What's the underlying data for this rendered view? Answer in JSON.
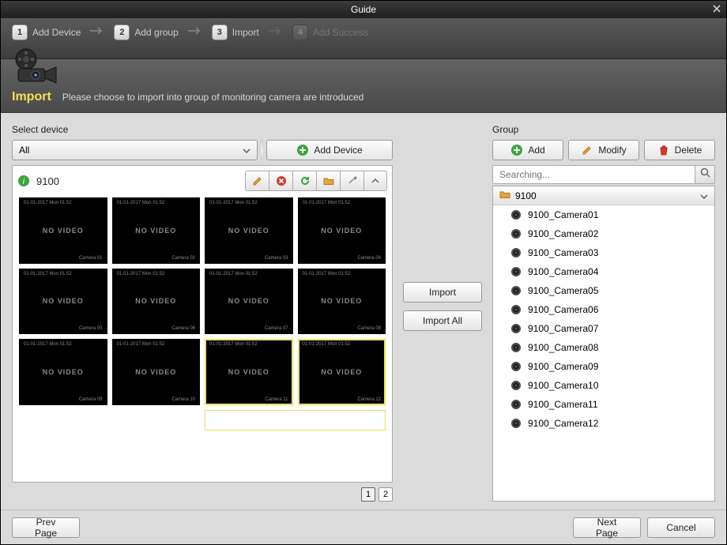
{
  "window": {
    "title": "Guide"
  },
  "steps": [
    {
      "num": "1",
      "label": "Add Device",
      "active": true
    },
    {
      "num": "2",
      "label": "Add group",
      "active": true
    },
    {
      "num": "3",
      "label": "Import",
      "active": true
    },
    {
      "num": "4",
      "label": "Add Success",
      "active": false
    }
  ],
  "banner": {
    "title": "Import",
    "subtitle": "Please choose to import into group of monitoring camera are introduced"
  },
  "left": {
    "label": "Select device",
    "filter_value": "All",
    "add_device_label": "Add Device",
    "device_name": "9100",
    "thumb_text": "NO VIDEO",
    "thumbs": [
      {
        "selected": false
      },
      {
        "selected": false
      },
      {
        "selected": false
      },
      {
        "selected": false
      },
      {
        "selected": false
      },
      {
        "selected": false
      },
      {
        "selected": false
      },
      {
        "selected": false
      },
      {
        "selected": false
      },
      {
        "selected": false
      },
      {
        "selected": true
      },
      {
        "selected": true
      }
    ],
    "pages": [
      "1",
      "2"
    ],
    "current_page": "1"
  },
  "middle": {
    "import_label": "Import",
    "import_all_label": "Import All"
  },
  "right": {
    "label": "Group",
    "add_label": "Add",
    "modify_label": "Modify",
    "delete_label": "Delete",
    "search_placeholder": "Searching...",
    "group_name": "9100",
    "cameras": [
      "9100_Camera01",
      "9100_Camera02",
      "9100_Camera03",
      "9100_Camera04",
      "9100_Camera05",
      "9100_Camera06",
      "9100_Camera07",
      "9100_Camera08",
      "9100_Camera09",
      "9100_Camera10",
      "9100_Camera11",
      "9100_Camera12"
    ]
  },
  "footer": {
    "prev_label": "Prev Page",
    "next_label": "Next Page",
    "cancel_label": "Cancel"
  }
}
